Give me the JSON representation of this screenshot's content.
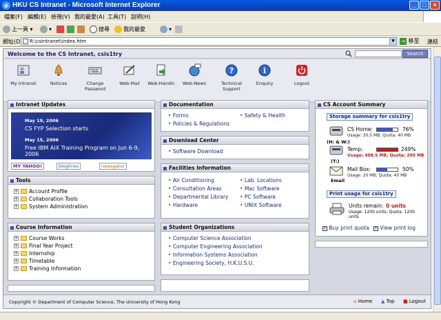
{
  "window": {
    "title": "HKU CS Intranet - Microsoft Internet Explorer",
    "menus": [
      "檔案(F)",
      "編輯(E)",
      "檢視(V)",
      "我的最愛(A)",
      "工具(T)",
      "說明(H)"
    ]
  },
  "toolbar": {
    "back": "上一頁",
    "search": "搜尋",
    "favorites": "我的最愛"
  },
  "address": {
    "label": "網址(D)",
    "value": "R:\\csintranet\\index.htm",
    "go": "移至",
    "links": "連結"
  },
  "welcome": {
    "text": "Welcome to the CS Intranet, csis1try",
    "search_button": "Search"
  },
  "nav_icons": [
    {
      "label": "My Intranet",
      "icon": "person-card-icon"
    },
    {
      "label": "Notices",
      "icon": "bell-icon"
    },
    {
      "label": "Change Password",
      "icon": "keyboard-icon"
    },
    {
      "label": "Web-Mail",
      "icon": "mail-pen-icon"
    },
    {
      "label": "Web-Handin",
      "icon": "handin-icon"
    },
    {
      "label": "Web-News",
      "icon": "globe-news-icon"
    },
    {
      "label": "Technical Support",
      "icon": "question-icon"
    },
    {
      "label": "Enquiry",
      "icon": "info-icon"
    },
    {
      "label": "Logout",
      "icon": "power-icon"
    }
  ],
  "intranet_updates": {
    "title": "Intranet Updates",
    "items": [
      {
        "date": "May 19, 2006",
        "text": "CS FYP Selection starts"
      },
      {
        "date": "May 15, 2006",
        "text": "Free IBM AIX Training Program on Jun 6-9, 2006"
      }
    ],
    "feeds": [
      "MY YAHOO!",
      "bloglines",
      "newsgator"
    ]
  },
  "tools": {
    "title": "Tools",
    "items": [
      "Account Profile",
      "Collaboration Tools",
      "System Administration"
    ]
  },
  "course_info": {
    "title": "Course Information",
    "items": [
      "Course Works",
      "Final Year Project",
      "Internship",
      "Timetable",
      "Training Information"
    ]
  },
  "documentation": {
    "title": "Documentation",
    "col1": [
      "Forms",
      "Policies & Regulations"
    ],
    "col2": [
      "Safety & Health"
    ]
  },
  "download_center": {
    "title": "Download Center",
    "items": [
      "Software Download"
    ]
  },
  "facilities": {
    "title": "Facilities Information",
    "col1": [
      "Air Conditioning",
      "Consultation Areas",
      "Departmental Library",
      "Hardware"
    ],
    "col2": [
      "Lab. Locations",
      "Mac Software",
      "PC Software",
      "UNIX Software"
    ]
  },
  "student_orgs": {
    "title": "Student Organizations",
    "items": [
      "Computer Science Association",
      "Computer Engineering Association",
      "Information Systems Association",
      "Engineering Society, H.K.U.S.U."
    ]
  },
  "account": {
    "title": "CS Account Summary",
    "storage_title": "Storage summary for csis1try",
    "storage": [
      {
        "name": "CS Home:",
        "drive": "(H: & W:)",
        "pct": "76%",
        "fill": 0.76,
        "usage": "Usage: 30.5 MB; Quota: 40 MB",
        "color": "#3b5bd0",
        "usage_color": "#222"
      },
      {
        "name": "Temp:",
        "drive": "(T:)",
        "pct": "249%",
        "fill": 1.0,
        "usage": "Usage: 498.5 MB; Quota: 200 MB",
        "color": "#d01818",
        "usage_color": "#d01818"
      },
      {
        "name": "Mail Box:",
        "drive": "Email",
        "pct": "50%",
        "fill": 0.5,
        "usage": "Usage: 20 MB; Quota: 40 MB",
        "color": "#3b5bd0",
        "usage_color": "#222"
      }
    ],
    "print_title": "Print usage for csis1try",
    "units_label": "Units remain:",
    "units_value": "0 units",
    "print_usage": "Usage: 1200 units; Quota: 1200 units",
    "buy_quota": "Buy print quota",
    "view_log": "View print log"
  },
  "footer": {
    "copyright": "Copyright © Department of Computer Science, The University of Hong Kong",
    "home": "Home",
    "top": "Top",
    "logout": "Logout"
  }
}
